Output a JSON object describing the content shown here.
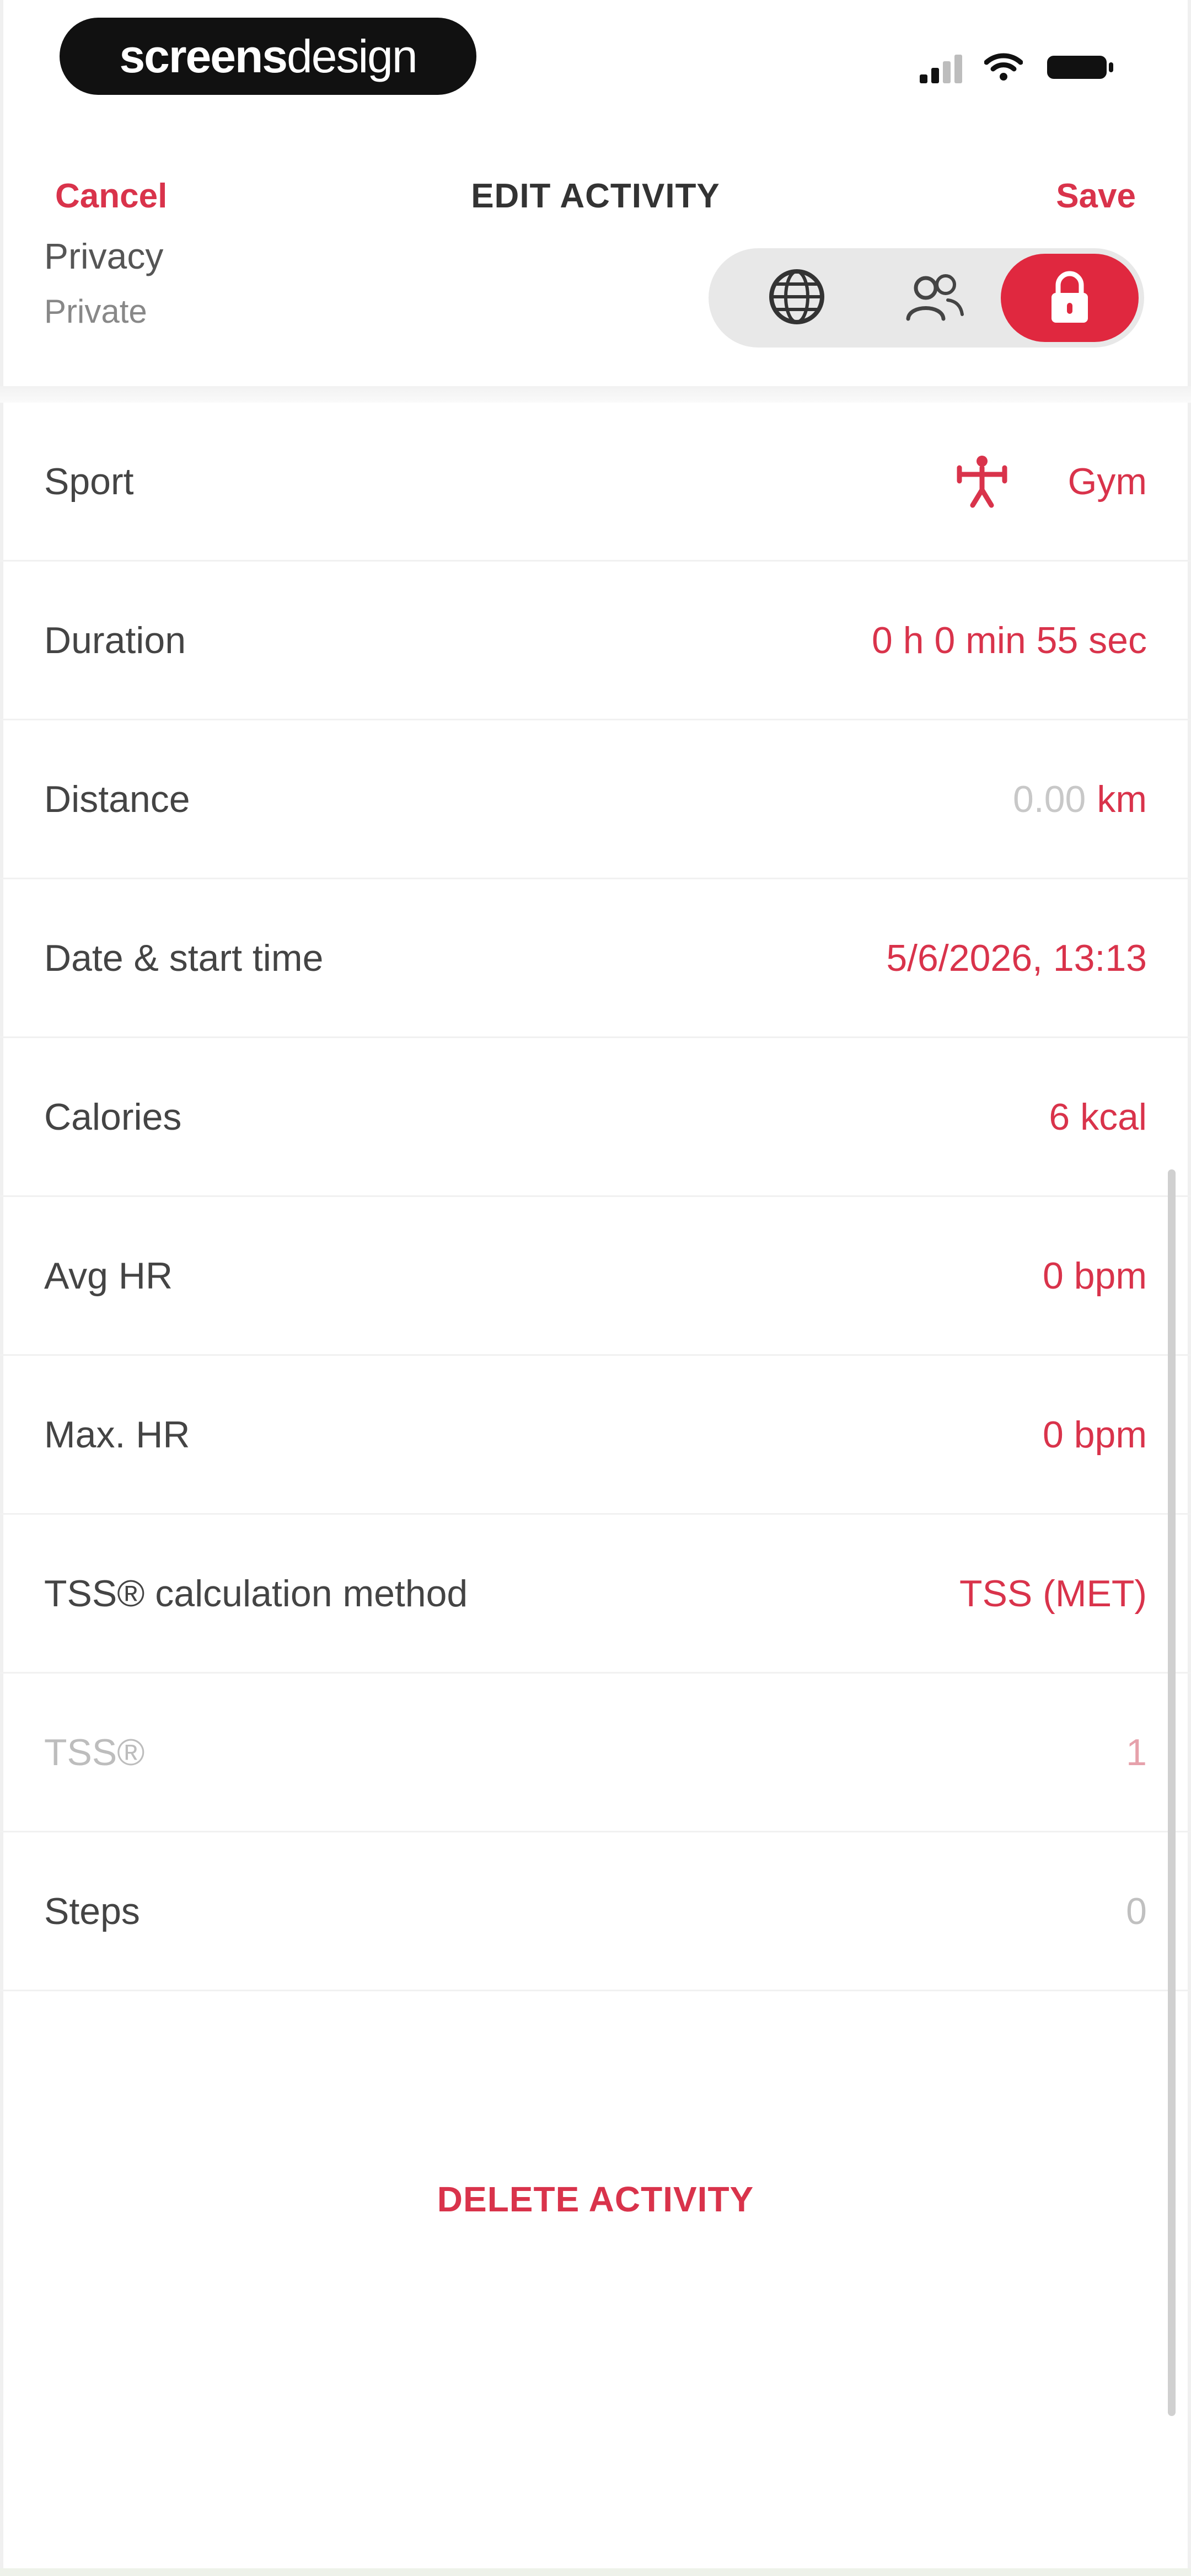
{
  "status_bar": {
    "brand_part1": "screens",
    "brand_part2": "design"
  },
  "nav": {
    "cancel": "Cancel",
    "title": "EDIT ACTIVITY",
    "save": "Save"
  },
  "privacy": {
    "label": "Privacy",
    "value": "Private",
    "options": [
      "globe-icon",
      "friends-icon",
      "lock-icon"
    ],
    "selected": "lock-icon"
  },
  "rows": {
    "sport": {
      "label": "Sport",
      "value": "Gym",
      "icon": "gym-icon"
    },
    "duration": {
      "label": "Duration",
      "value": "0 h 0 min 55 sec"
    },
    "distance": {
      "label": "Distance",
      "value": "0.00",
      "unit": "km"
    },
    "date": {
      "label": "Date & start time",
      "value": "5/6/2026, 13:13"
    },
    "calories": {
      "label": "Calories",
      "value": "6 kcal"
    },
    "avg_hr": {
      "label": "Avg HR",
      "value": "0 bpm"
    },
    "max_hr": {
      "label": "Max. HR",
      "value": "0 bpm"
    },
    "tss_method": {
      "label": "TSS® calculation method",
      "value": "TSS (MET)"
    },
    "tss": {
      "label": "TSS®",
      "value": "1"
    },
    "steps": {
      "label": "Steps",
      "value": "0"
    }
  },
  "delete_label": "DELETE ACTIVITY",
  "colors": {
    "accent": "#d9334b",
    "toggle_active": "#e0283f",
    "toggle_bg": "#e8e8e8"
  }
}
